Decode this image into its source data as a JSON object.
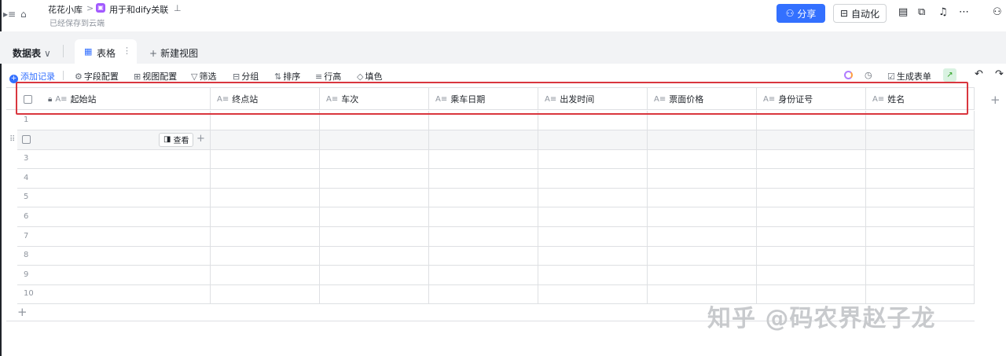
{
  "topbar": {
    "breadcrumb_root": "花花小库",
    "breadcrumb_sep": ">",
    "base_name": "用于和dify关联",
    "saved_status": "已经保存到云端",
    "share_label": "分享",
    "automation_label": "自动化"
  },
  "tabs": {
    "data_table": "数据表",
    "grid_view": "表格",
    "new_view": "新建视图"
  },
  "toolbar": {
    "add_record": "添加记录",
    "field_config": "字段配置",
    "view_config": "视图配置",
    "filter": "筛选",
    "group": "分组",
    "sort": "排序",
    "row_height": "行高",
    "fill_color": "填色",
    "generate_form": "生成表单"
  },
  "table": {
    "columns": [
      "起始站",
      "终点站",
      "车次",
      "乘车日期",
      "出发时间",
      "票面价格",
      "身份证号",
      "姓名"
    ],
    "rows": [
      "1",
      "",
      "3",
      "4",
      "5",
      "6",
      "7",
      "8",
      "9",
      "10"
    ],
    "view_button": "查看"
  },
  "watermark": "知乎 @码农界赵子龙",
  "colors": {
    "accent": "#3370ff",
    "highlight": "#d9363e"
  }
}
